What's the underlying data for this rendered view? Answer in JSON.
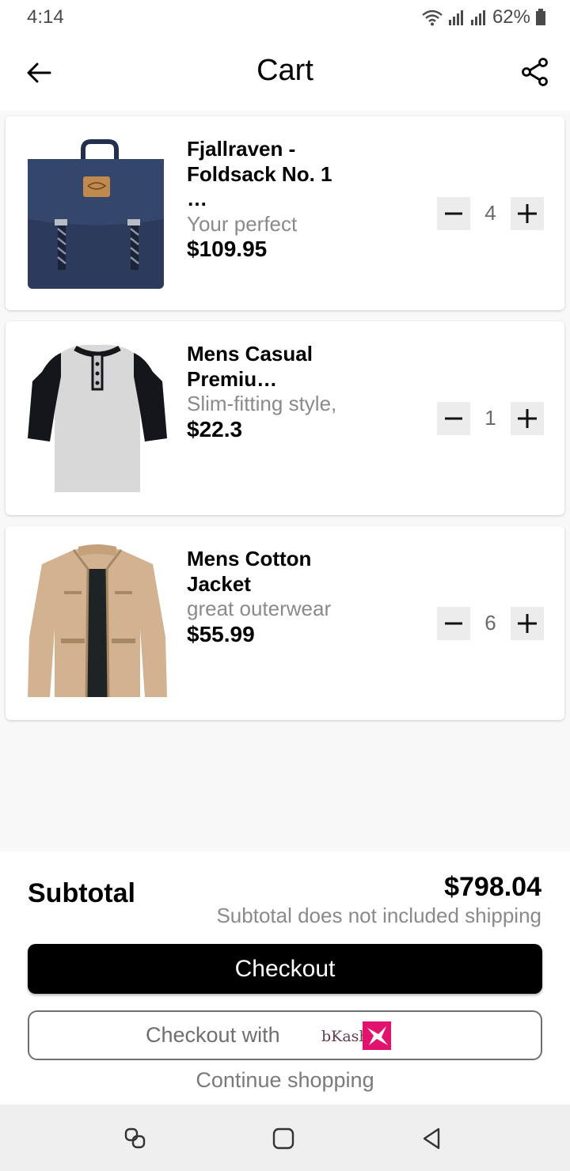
{
  "status_bar": {
    "time": "4:14",
    "battery": "62%"
  },
  "header": {
    "title": "Cart"
  },
  "items": [
    {
      "name": "Fjallraven - Foldsack No. 1 …",
      "desc": "Your perfect",
      "price": "$109.95",
      "qty": "4"
    },
    {
      "name": "Mens Casual Premiu…",
      "desc": "Slim-fitting style,",
      "price": "$22.3",
      "qty": "1"
    },
    {
      "name": "Mens Cotton Jacket",
      "desc": "great outerwear",
      "price": "$55.99",
      "qty": "6"
    }
  ],
  "summary": {
    "subtotal_label": "Subtotal",
    "subtotal_value": "$798.04",
    "note": "Subtotal does not included shipping",
    "checkout_label": "Checkout",
    "bkash_label": "Checkout with",
    "bkash_brand": "bKash",
    "continue_label": "Continue shopping"
  },
  "colors": {
    "bkash_pink": "#e2136e",
    "button_black": "#000000",
    "muted_text": "#8a8a8a"
  }
}
